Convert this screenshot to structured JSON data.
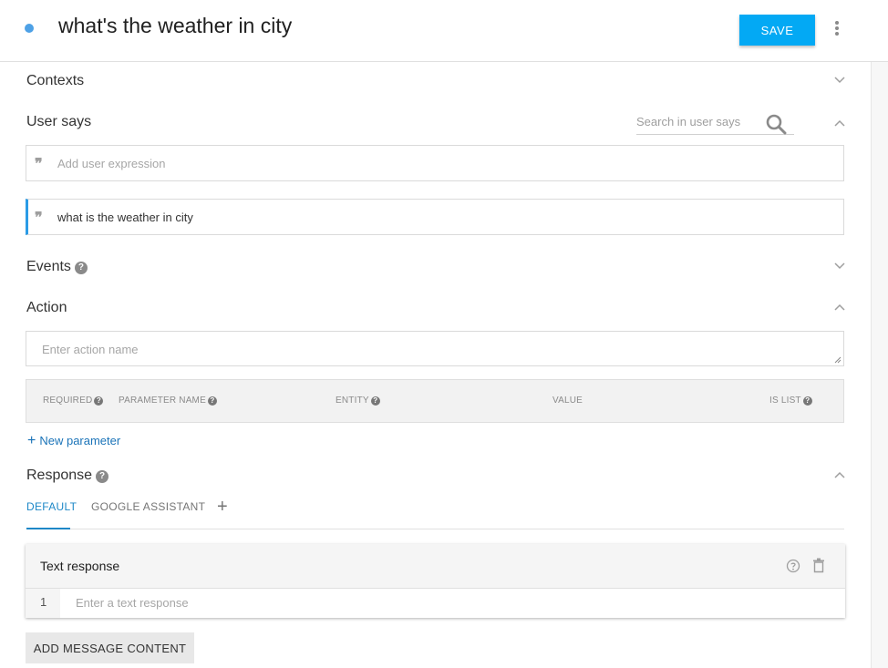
{
  "header": {
    "intent_name": "what's the weather in city",
    "save_label": "SAVE",
    "accent_color": "#03a9f4"
  },
  "sections": {
    "contexts": {
      "title": "Contexts"
    },
    "user_says": {
      "title": "User says",
      "search_placeholder": "Search in user says",
      "add_placeholder": "Add user expression",
      "expressions": [
        "what is the weather in city"
      ]
    },
    "events": {
      "title": "Events"
    },
    "action": {
      "title": "Action",
      "name_placeholder": "Enter action name",
      "columns": [
        "REQUIRED",
        "PARAMETER NAME",
        "ENTITY",
        "VALUE",
        "IS LIST"
      ],
      "new_parameter_label": "New parameter"
    },
    "response": {
      "title": "Response",
      "tabs": [
        "DEFAULT",
        "GOOGLE ASSISTANT"
      ],
      "active_tab": "DEFAULT",
      "card_title": "Text response",
      "row_number": "1",
      "row_placeholder": "Enter a text response",
      "add_message_label": "ADD MESSAGE CONTENT"
    }
  },
  "icons": [
    "more-vert-icon",
    "chevron-down-icon",
    "chevron-up-icon",
    "search-icon",
    "quote-icon",
    "help-icon",
    "plus-icon",
    "delete-icon"
  ]
}
